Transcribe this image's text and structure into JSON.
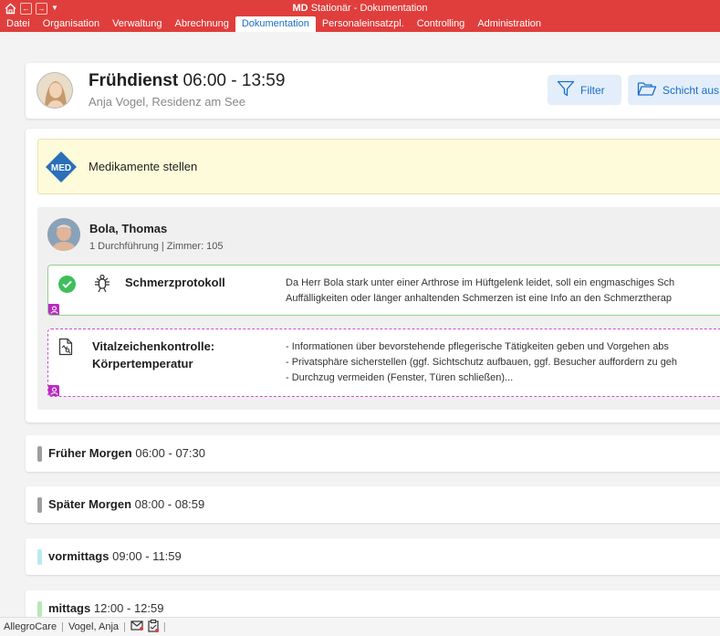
{
  "titlebar": {
    "app_brand": "MD",
    "app_title": "Stationär - Dokumentation",
    "quick_access": [
      "home-icon",
      "back-icon",
      "forward-icon",
      "dropdown-icon"
    ],
    "color": "#e03e3c"
  },
  "menu": {
    "items": [
      {
        "label": "Datei"
      },
      {
        "label": "Organisation"
      },
      {
        "label": "Verwaltung"
      },
      {
        "label": "Abrechnung"
      },
      {
        "label": "Dokumentation",
        "active": true
      },
      {
        "label": "Personaleinsatzpl."
      },
      {
        "label": "Controlling"
      },
      {
        "label": "Administration"
      }
    ]
  },
  "shift": {
    "name": "Frühdienst",
    "time": "06:00 - 13:59",
    "subtitle": "Anja Vogel, Residenz am See"
  },
  "buttons": {
    "filter_label": "Filter",
    "schicht_label": "Schicht aus"
  },
  "med_banner": {
    "icon_text": "MED",
    "label": "Medikamente stellen",
    "color": "#fdfbd9"
  },
  "resident": {
    "name": "Bola, Thomas",
    "subtitle": "1 Durchführung | Zimmer: 105"
  },
  "tasks": [
    {
      "title": "Schmerzprotokoll",
      "status": "done",
      "desc_lines": [
        "Da Herr Bola stark unter einer Arthrose im Hüftgelenk leidet, soll ein engmaschiges Sch",
        "Auffälligkeiten oder länger anhaltenden Schmerzen ist eine Info an den Schmerztherap"
      ]
    },
    {
      "title_line1": "Vitalzeichenkontrolle:",
      "title_line2": "Körpertemperatur",
      "status": "open",
      "desc_lines": [
        "- Informationen über bevorstehende pflegerische Tätigkeiten geben und Vorgehen abs",
        "- Privatsphäre sicherstellen (ggf. Sichtschutz aufbauen, ggf. Besucher auffordern zu geh",
        "- Durchzug vermeiden (Fenster, Türen schließen)..."
      ]
    }
  ],
  "time_slots": [
    {
      "name": "Früher Morgen",
      "time": "06:00 - 07:30",
      "color": "#9e9e9e"
    },
    {
      "name": "Später Morgen",
      "time": "08:00 - 08:59",
      "color": "#9e9e9e"
    },
    {
      "name": "vormittags",
      "time": "09:00 - 11:59",
      "color": "#b9eaf0"
    },
    {
      "name": "mittags",
      "time": "12:00 - 12:59",
      "color": "#b7e9b4"
    }
  ],
  "statusbar": {
    "app": "AllegroCare",
    "user": "Vogel, Anja"
  }
}
